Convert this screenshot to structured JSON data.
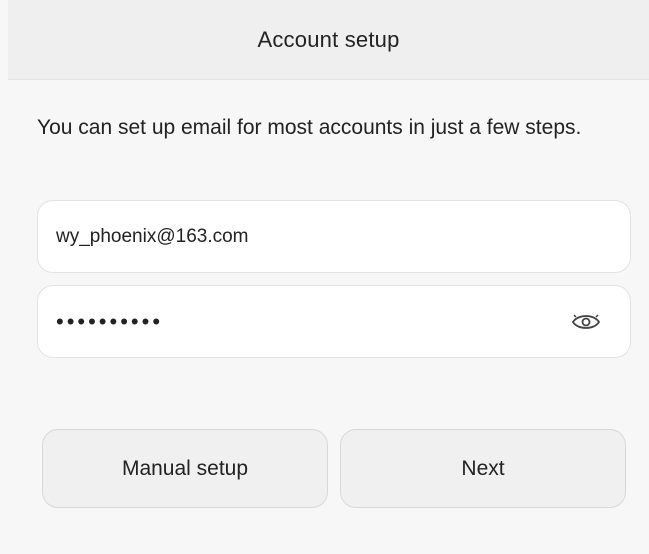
{
  "header": {
    "title": "Account setup"
  },
  "main": {
    "intro_text": "You can set up email for most accounts in just a few steps.",
    "email_field": {
      "value": "wy_phoenix@163.com"
    },
    "password_field": {
      "masked_value": "••••••••••",
      "toggle_icon": "eye-icon"
    },
    "buttons": {
      "manual_setup_label": "Manual setup",
      "next_label": "Next"
    }
  }
}
